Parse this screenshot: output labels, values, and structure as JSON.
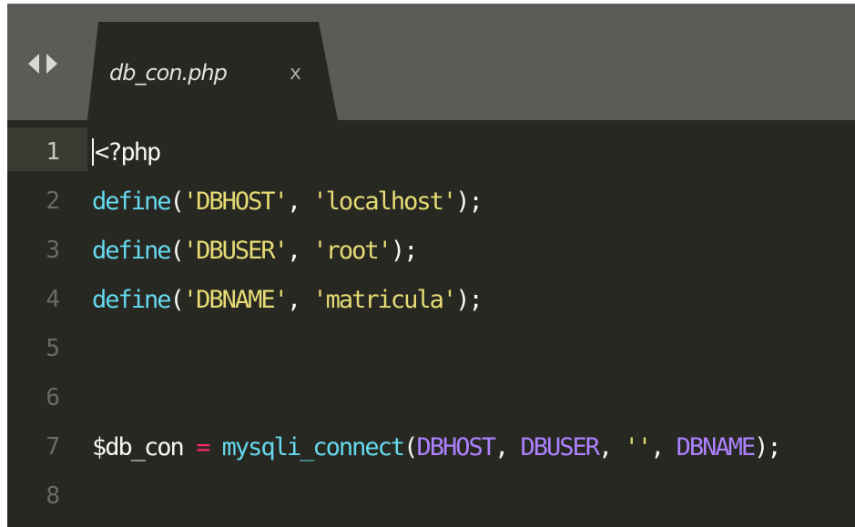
{
  "colors": {
    "editor_bg": "#272822",
    "tabbar_bg": "#5b5b57",
    "function": "#66d9ef",
    "string": "#e6db74",
    "constant": "#ae81ff",
    "operator": "#f92672",
    "text": "#f8f8f2",
    "line_number": "#6b6b64"
  },
  "tabbar": {
    "nav_icon": "left-right-arrows-icon",
    "tab": {
      "title": "db_con.php",
      "close": "x"
    }
  },
  "editor": {
    "active_line": 1,
    "lines": [
      {
        "number": "1",
        "tokens": [
          {
            "text": "<?php",
            "kind": "text"
          }
        ]
      },
      {
        "number": "2",
        "tokens": [
          {
            "text": "define",
            "kind": "fn"
          },
          {
            "text": "(",
            "kind": "punc"
          },
          {
            "text": "'DBHOST'",
            "kind": "str"
          },
          {
            "text": ", ",
            "kind": "punc"
          },
          {
            "text": "'localhost'",
            "kind": "str"
          },
          {
            "text": ");",
            "kind": "punc"
          }
        ]
      },
      {
        "number": "3",
        "tokens": [
          {
            "text": "define",
            "kind": "fn"
          },
          {
            "text": "(",
            "kind": "punc"
          },
          {
            "text": "'DBUSER'",
            "kind": "str"
          },
          {
            "text": ", ",
            "kind": "punc"
          },
          {
            "text": "'root'",
            "kind": "str"
          },
          {
            "text": ");",
            "kind": "punc"
          }
        ]
      },
      {
        "number": "4",
        "tokens": [
          {
            "text": "define",
            "kind": "fn"
          },
          {
            "text": "(",
            "kind": "punc"
          },
          {
            "text": "'DBNAME'",
            "kind": "str"
          },
          {
            "text": ", ",
            "kind": "punc"
          },
          {
            "text": "'matricula'",
            "kind": "str"
          },
          {
            "text": ");",
            "kind": "punc"
          }
        ]
      },
      {
        "number": "5",
        "tokens": []
      },
      {
        "number": "6",
        "tokens": []
      },
      {
        "number": "7",
        "tokens": [
          {
            "text": "$db_con",
            "kind": "var"
          },
          {
            "text": " ",
            "kind": "punc"
          },
          {
            "text": "=",
            "kind": "op"
          },
          {
            "text": " ",
            "kind": "punc"
          },
          {
            "text": "mysqli_connect",
            "kind": "fn"
          },
          {
            "text": "(",
            "kind": "punc"
          },
          {
            "text": "DBHOST",
            "kind": "const"
          },
          {
            "text": ", ",
            "kind": "punc"
          },
          {
            "text": "DBUSER",
            "kind": "const"
          },
          {
            "text": ", ",
            "kind": "punc"
          },
          {
            "text": "''",
            "kind": "str"
          },
          {
            "text": ", ",
            "kind": "punc"
          },
          {
            "text": "DBNAME",
            "kind": "const"
          },
          {
            "text": ");",
            "kind": "punc"
          }
        ]
      },
      {
        "number": "8",
        "tokens": []
      }
    ]
  }
}
